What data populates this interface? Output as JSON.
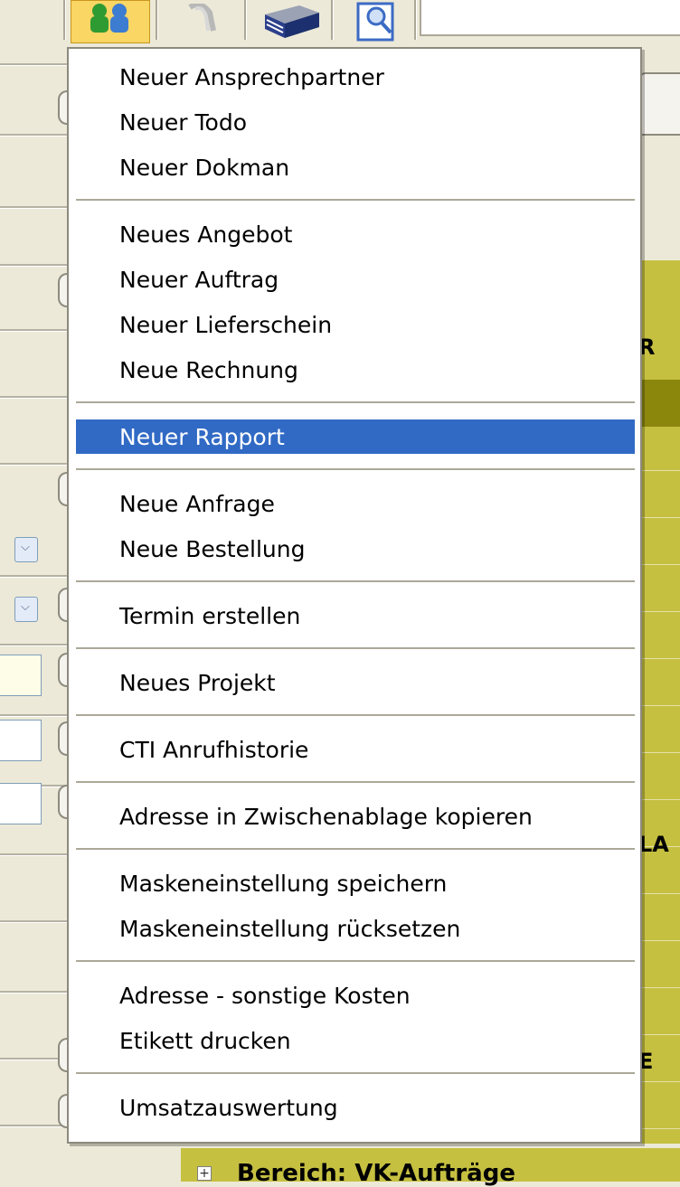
{
  "toolbar": {
    "buttons": [
      {
        "icon": "people-icon"
      },
      {
        "icon": "paperclip-icon"
      },
      {
        "icon": "stack-icon"
      },
      {
        "icon": "magnifier-icon"
      }
    ]
  },
  "context_menu": {
    "selected_color": "#316ac5",
    "groups": [
      [
        "Neuer Ansprechpartner",
        "Neuer Todo",
        "Neuer Dokman"
      ],
      [
        "Neues Angebot",
        "Neuer Auftrag",
        "Neuer Lieferschein",
        "Neue Rechnung"
      ],
      [
        "Neuer Rapport"
      ],
      [
        "Neue Anfrage",
        "Neue Bestellung"
      ],
      [
        "Termin erstellen"
      ],
      [
        "Neues Projekt"
      ],
      [
        "CTI Anrufhistorie"
      ],
      [
        "Adresse in Zwischenablage kopieren"
      ],
      [
        "Maskeneinstellung speichern",
        "Maskeneinstellung rücksetzen"
      ],
      [
        "Adresse - sonstige Kosten",
        "Etikett drucken"
      ],
      [
        "Umsatzauswertung"
      ]
    ],
    "selected_item": "Neuer Rapport"
  },
  "background": {
    "right_labels": [
      "R",
      "LA",
      "E"
    ],
    "bottom_section": "Bereich: VK-Aufträge",
    "expand_symbol": "+",
    "dropdown_symbol": "⌵",
    "olive_color": "#c6c041"
  }
}
